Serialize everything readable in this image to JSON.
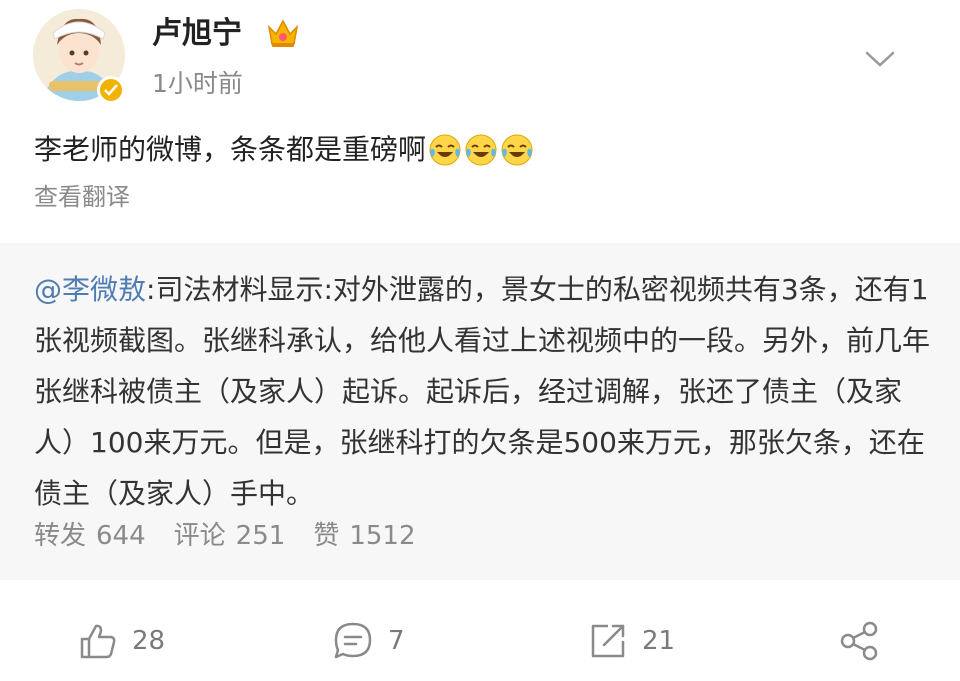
{
  "post": {
    "username": "卢旭宁",
    "timestamp": "1小时前",
    "text": "李老师的微博，条条都是重磅啊",
    "translate_label": "查看翻译",
    "emoji_icons": [
      "laugh-cry-icon",
      "laugh-cry-icon",
      "laugh-cry-icon"
    ]
  },
  "repost": {
    "mention": "@李微敖",
    "body": ":司法材料显示:对外泄露的，景女士的私密视频共有3条，还有1张视频截图。张继科承认，给他人看过上述视频中的一段。另外，前几年张继科被债主（及家人）起诉。起诉后，经过调解，张还了债主（及家人）100来万元。但是，张继科打的欠条是500来万元，那张欠条，还在债主（及家人）手中。",
    "stats": [
      {
        "label": "转发",
        "count": "644"
      },
      {
        "label": "评论",
        "count": "251"
      },
      {
        "label": "赞",
        "count": "1512"
      }
    ]
  },
  "actions": {
    "like_count": "28",
    "comment_count": "7",
    "repost_count": "21"
  },
  "colors": {
    "mention": "#4f7db3",
    "muted_text": "#8a8a8a",
    "repost_bg": "#f7f7f7",
    "verified_badge": "#f2b200"
  }
}
